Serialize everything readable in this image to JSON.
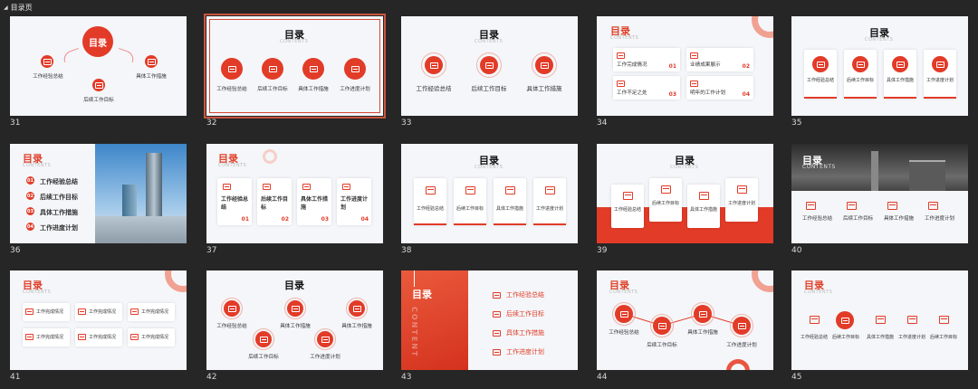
{
  "panel": {
    "title": "目录页"
  },
  "common": {
    "title": "目录",
    "contents": "CONTENTS",
    "items4": [
      "工作经验总结",
      "后续工作目标",
      "具体工作措施",
      "工作进度计划"
    ],
    "nums": [
      "01",
      "02",
      "03",
      "04"
    ]
  },
  "slides": [
    {
      "num": "31"
    },
    {
      "num": "32"
    },
    {
      "num": "33"
    },
    {
      "num": "34"
    },
    {
      "num": "35"
    },
    {
      "num": "36"
    },
    {
      "num": "37"
    },
    {
      "num": "38"
    },
    {
      "num": "39"
    },
    {
      "num": "40"
    },
    {
      "num": "41"
    },
    {
      "num": "42"
    },
    {
      "num": "43"
    },
    {
      "num": "44"
    },
    {
      "num": "45"
    }
  ],
  "s34": {
    "items": [
      "工作完成情况",
      "业绩成果展示",
      "工作不足之处",
      "明年的工作计划"
    ]
  },
  "s37": {
    "items": [
      "工作经验总结",
      "后续工作目标",
      "具体工作措施",
      "工作进度计划"
    ]
  },
  "s41": {
    "item": "工作完成情况"
  },
  "s43": {
    "vertical": "CONTENT"
  },
  "s45": {
    "items": [
      "工作经验总结",
      "后续工作目标",
      "具体工作措施",
      "工作进度计划",
      "后续工作目标"
    ]
  }
}
